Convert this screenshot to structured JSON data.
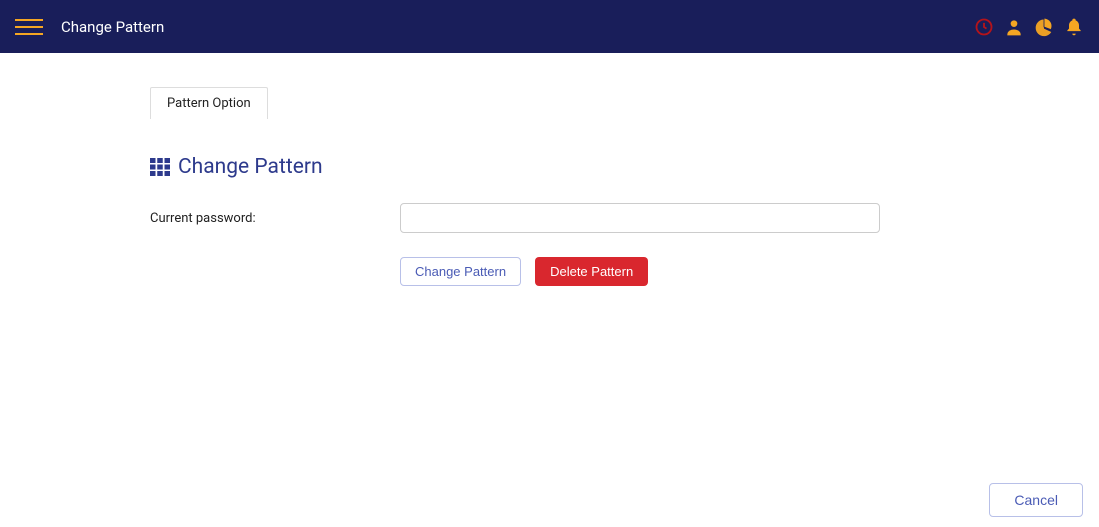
{
  "header": {
    "title": "Change  Pattern",
    "icons": {
      "menu": "hamburger-icon",
      "clock": "clock-icon",
      "user": "user-icon",
      "chart": "pie-chart-icon",
      "bell": "bell-icon"
    }
  },
  "tabs": [
    {
      "label": "Pattern Option"
    }
  ],
  "section": {
    "icon": "grid-icon",
    "title": "Change Pattern"
  },
  "form": {
    "current_password_label": "Current password:",
    "current_password_value": ""
  },
  "buttons": {
    "change": "Change Pattern",
    "delete": "Delete Pattern",
    "cancel": "Cancel"
  },
  "colors": {
    "header_bg": "#191e5a",
    "accent_orange": "#f5a623",
    "accent_red": "#d9272e",
    "accent_blue": "#2d3a8c",
    "danger_red": "#b5131a"
  }
}
